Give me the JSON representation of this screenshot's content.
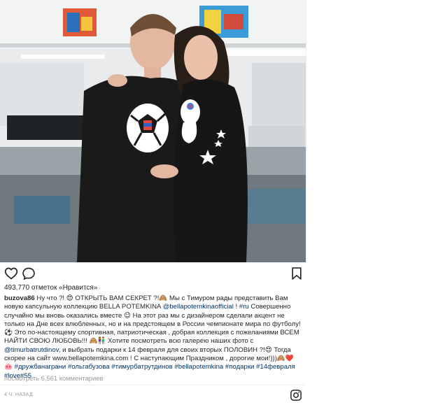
{
  "post": {
    "likes_text": "493,770 отметок «Нравится»",
    "caption": {
      "username": "buzova86",
      "p1": " Ну что ?! 😍 ОТКРЫТЬ ВАМ СЕКРЕТ ?!🙈 Мы с Тимуром рады представить Вам новую капсульную коллекцию BELLA POTEMKINA ",
      "mention1": "@bellapotemkinaofficial",
      "p2": " ! ",
      "mention2": "#ru",
      "p3": " Совершенно случайно мы вновь оказались вместе 😉 На этот раз мы с дизайнером сделали акцент не только на Дне всех влюбленных, но и на предстоящем в России чемпионате мира по футболу! ⚽ Это по-настоящему спортивная, патриотическая , добрая коллекция с пожеланиями ВСЕМ НАЙТИ СВОЮ ЛЮБОВЬ!!! 🙈👫 Хотите посмотреть всю галерею наших фото с ",
      "mention3": "@timurbatrutdinov",
      "p4": ", и выбрать подарки к 14 февраля для своих вторых ПОЛОВИН ?!😍 Тогда скорее на сайт www.bellapotemkina.com ! С наступающим Праздником , дорогие мои!)))🙈❤️🐽 ",
      "hashtags": "#дружбанаграни #ольгабузова #тимурбатрутдинов #bellapotemkina #подарки #14февраля #love#55"
    },
    "view_comments": "посмотреть 6,561 комментариев",
    "timestamp": "4 ч. назад"
  },
  "icons": {
    "like": "heart-outline-icon",
    "comment": "speech-bubble-icon",
    "save": "bookmark-icon",
    "instagram": "instagram-logo-icon"
  },
  "colors": {
    "text": "#262626",
    "link": "#003569",
    "muted": "#999999"
  }
}
